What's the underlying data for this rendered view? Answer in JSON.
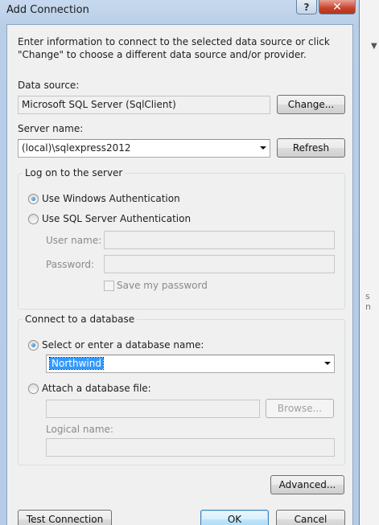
{
  "window": {
    "title": "Add Connection",
    "help_glyph": "?",
    "close_glyph": "✕"
  },
  "intro": "Enter information to connect to the selected data source or click \"Change\" to choose a different data source and/or provider.",
  "data_source": {
    "label": "Data source:",
    "value": "Microsoft SQL Server (SqlClient)",
    "change_button": "Change..."
  },
  "server": {
    "label": "Server name:",
    "value": "(local)\\sqlexpress2012",
    "refresh_button": "Refresh"
  },
  "logon": {
    "group_title": "Log on to the server",
    "windows_auth": "Use Windows Authentication",
    "sql_auth": "Use SQL Server Authentication",
    "selected": "windows",
    "user_name_label": "User name:",
    "password_label": "Password:",
    "save_password": "Save my password"
  },
  "database": {
    "group_title": "Connect to a database",
    "select_option": "Select or enter a database name:",
    "db_name": "Northwind",
    "attach_option": "Attach a database file:",
    "browse_button": "Browse...",
    "logical_name_label": "Logical name:",
    "selected": "select"
  },
  "buttons": {
    "advanced": "Advanced...",
    "test_connection": "Test Connection",
    "ok": "OK",
    "cancel": "Cancel"
  },
  "background": {
    "fragment1": "s",
    "fragment2": "n"
  }
}
